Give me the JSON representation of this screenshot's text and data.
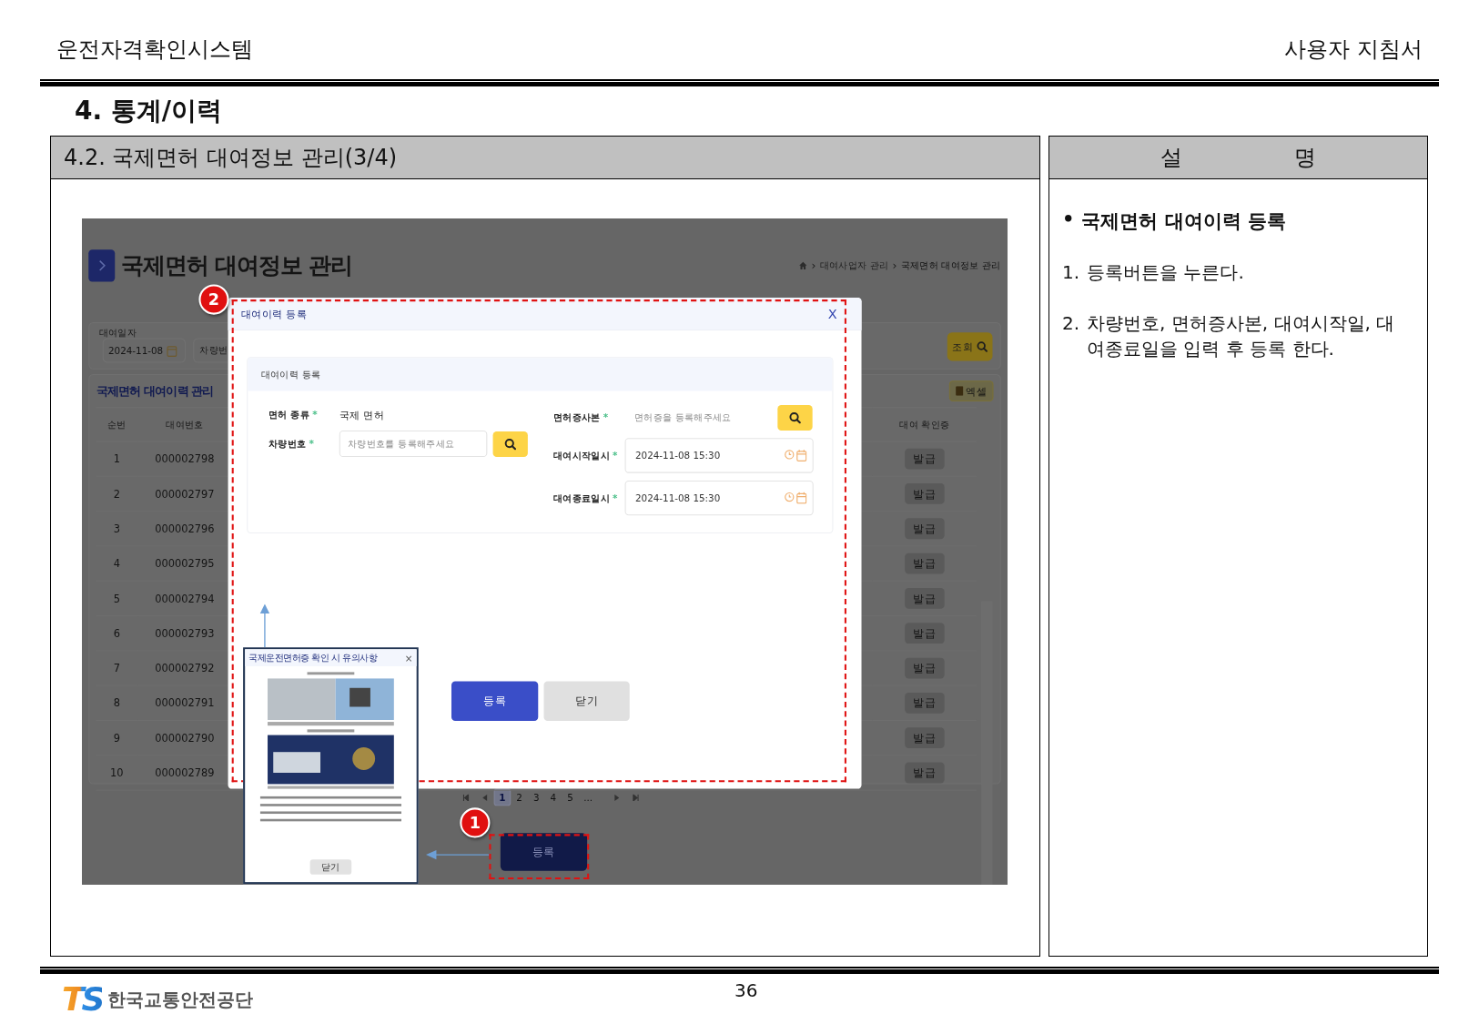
{
  "header": {
    "system_name": "운전자격확인시스템",
    "doc_title": "사용자 지침서"
  },
  "section_title": "4. 통계/이력",
  "left_panel": {
    "title": "4.2. 국제면허 대여정보 관리(3/4)"
  },
  "screenshot": {
    "page_title": "국제면허 대여정보 관리",
    "breadcrumb": [
      "대여사업자 관리",
      "국제면허 대여정보 관리"
    ],
    "breadcrumb_separator": "›",
    "filter": {
      "date_label": "대여일자",
      "date_value": "2024-11-08",
      "vehicle_placeholder": "차량번",
      "search_button": "조회"
    },
    "table": {
      "title": "국제면허 대여이력 관리",
      "excel_button": "엑셀",
      "columns": [
        "순번",
        "대여번호",
        "대여 확인증"
      ],
      "rows": [
        {
          "no": "1",
          "rental_no": "000002798",
          "action": "발급"
        },
        {
          "no": "2",
          "rental_no": "000002797",
          "action": "발급"
        },
        {
          "no": "3",
          "rental_no": "000002796",
          "action": "발급"
        },
        {
          "no": "4",
          "rental_no": "000002795",
          "action": "발급"
        },
        {
          "no": "5",
          "rental_no": "000002794",
          "action": "발급"
        },
        {
          "no": "6",
          "rental_no": "000002793",
          "action": "발급"
        },
        {
          "no": "7",
          "rental_no": "000002792",
          "action": "발급"
        },
        {
          "no": "8",
          "rental_no": "000002791",
          "action": "발급"
        },
        {
          "no": "9",
          "rental_no": "000002790",
          "action": "발급"
        },
        {
          "no": "10",
          "rental_no": "000002789",
          "action": "발급"
        }
      ]
    },
    "pagination": {
      "pages": [
        {
          "label": "1",
          "selected": true
        },
        {
          "label": "2",
          "selected": false
        },
        {
          "label": "3",
          "selected": false
        },
        {
          "label": "4",
          "selected": false
        },
        {
          "label": "5",
          "selected": false
        }
      ],
      "ellipsis": "..."
    },
    "register_button": "등록",
    "modal": {
      "title": "대여이력 등록",
      "close": "X",
      "section_title": "대여이력 등록",
      "required_mark": "*",
      "left_fields": [
        {
          "kind": "text",
          "label": "면허 종류",
          "required": true,
          "value": "국제 면허"
        },
        {
          "kind": "search",
          "label": "차량번호",
          "required": true,
          "placeholder": "차량번호를 등록해주세요"
        }
      ],
      "right_fields": [
        {
          "kind": "search_plain",
          "label": "면허증사본",
          "required": true,
          "placeholder": "면허증을 등록해주세요"
        },
        {
          "kind": "datetime",
          "label": "대여시작일시",
          "required": true,
          "value": "2024-11-08 15:30"
        },
        {
          "kind": "datetime",
          "label": "대여종료일시",
          "required": true,
          "value": "2024-11-08 15:30"
        }
      ],
      "buttons": [
        {
          "label": "등록",
          "kind": "primary"
        },
        {
          "label": "닫기",
          "kind": "secondary"
        }
      ]
    },
    "notice_popup": {
      "title": "국제운전면허증 확인 시 유의사항",
      "close": "×",
      "close_button": "닫기"
    },
    "callouts": [
      {
        "label": "1"
      },
      {
        "label": "2"
      }
    ]
  },
  "description": {
    "header": [
      "설",
      "명"
    ],
    "bullet": "•",
    "heading": "국제면허 대여이력 등록",
    "steps": [
      {
        "number": "1.",
        "text": "등록버튼을 누른다."
      },
      {
        "number": "2.",
        "text": "차량번호, 면허증사본, 대여시작일, 대여종료일을 입력 후 등록 한다."
      }
    ]
  },
  "footer": {
    "logo": "TS",
    "org": "한국교통안전공단",
    "page": "36"
  }
}
